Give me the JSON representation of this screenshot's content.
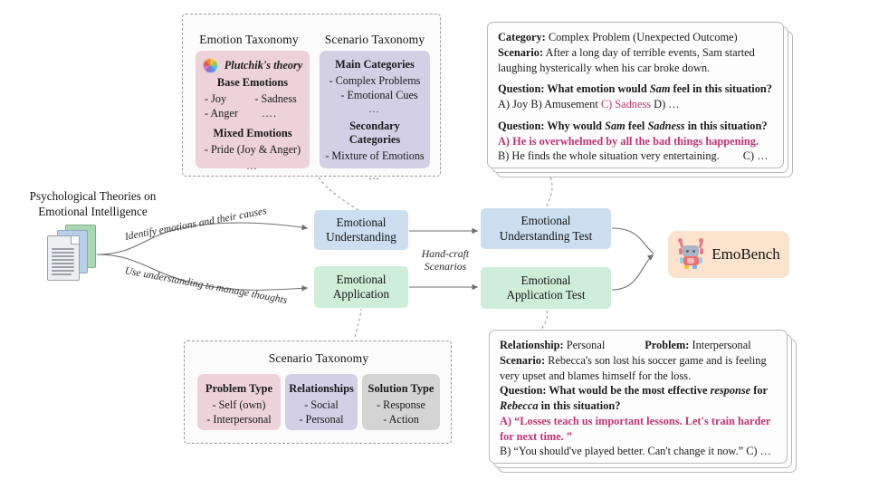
{
  "source": {
    "title_line1": "Psychological Theories on",
    "title_line2": "Emotional Intelligence",
    "icon": "document-stack-icon"
  },
  "arrow_labels": {
    "top": "Identify emotions and their causes",
    "bottom": "Use understanding to manage thoughts",
    "handcraft_line1": "Hand-craft",
    "handcraft_line2": "Scenarios"
  },
  "flow": {
    "understanding_line1": "Emotional",
    "understanding_line2": "Understanding",
    "application_line1": "Emotional",
    "application_line2": "Application",
    "understanding_test_line1": "Emotional",
    "understanding_test_line2": "Understanding Test",
    "application_test_line1": "Emotional",
    "application_test_line2": "Application Test",
    "blue": "#cddef0",
    "green": "#cfeeda"
  },
  "benchmark": {
    "name": "EmoBench",
    "icon": "robot-icon",
    "bg": "#fce3cd"
  },
  "emotion_taxonomy_panel": {
    "emotion_title": "Emotion Taxonomy",
    "scenario_title": "Scenario Taxonomy",
    "emotion_card": {
      "theory_label": "Plutchik's theory",
      "theory_icon": "color-wheel-icon",
      "base_heading": "Base Emotions",
      "base_items": [
        "- Joy",
        "- Sadness",
        "- Anger",
        "…."
      ],
      "mixed_heading": "Mixed  Emotions",
      "mixed_items": [
        "- Pride (Joy & Anger)"
      ],
      "ellipsis": "…",
      "bg": "#edd2da"
    },
    "scenario_card": {
      "main_heading": "Main Categories",
      "main_items": [
        "- Complex Problems",
        "- Emotional Cues"
      ],
      "main_ellipsis": "…",
      "secondary_heading": "Secondary Categories",
      "secondary_items": [
        "- Mixture of Emotions"
      ],
      "secondary_ellipsis": "…",
      "bg": "#d3d0e6"
    }
  },
  "scenario_taxonomy_panel": {
    "title": "Scenario Taxonomy",
    "columns": [
      {
        "heading": "Problem Type",
        "items": [
          "- Self (own)",
          "- Interpersonal"
        ],
        "bg": "#edd2da"
      },
      {
        "heading": "Relationships",
        "items": [
          "- Social",
          "- Personal"
        ],
        "bg": "#d3d0e6"
      },
      {
        "heading": "Solution Type",
        "items": [
          "- Response",
          "- Action"
        ],
        "bg": "#d4d4d4"
      }
    ]
  },
  "understanding_example": {
    "category_label": "Category:",
    "category_value": "Complex Problem (Unexpected Outcome)",
    "scenario_label": "Scenario:",
    "scenario_value_line1": "After a long day of terrible events, Sam started",
    "scenario_value_line2": "laughing hysterically when his car broke down.",
    "q1_prefix": "Question: What emotion would",
    "q1_name": "Sam",
    "q1_suffix": "feel in this situation?",
    "q1_options_a": "A) Joy B) Amusement ",
    "q1_options_correct": "C) Sadness",
    "q1_options_rest": " D) …",
    "q2_prefix": "Question: Why would",
    "q2_name": "Sam",
    "q2_mid": "feel",
    "q2_emotion": "Sadness",
    "q2_suffix": "in this situation?",
    "q2_option_a": "A) He is overwhelmed by all the bad things happening.",
    "q2_option_b": "B) He finds the whole situation very entertaining.",
    "q2_option_c": "C) …"
  },
  "application_example": {
    "relationship_label": "Relationship:",
    "relationship_value": "Personal",
    "problem_label": "Problem:",
    "problem_value": "Interpersonal",
    "scenario_label": "Scenario:",
    "scenario_value_line1": "Rebecca's son lost his soccer game and is feeling",
    "scenario_value_line2": "very upset and blames himself for the loss.",
    "q_prefix": "Question: What would be the most effective",
    "q_emph": "response",
    "q_for": "for",
    "q_name": "Rebecca",
    "q_suffix": "in this situation?",
    "opt_a_line1": "A) “Losses teach us important lessons. Let's train harder",
    "opt_a_line2": "for next time. ”",
    "opt_b": "B) “You should've played better. Can't change it now.” C) …"
  },
  "colors": {
    "highlight": "#bf3573",
    "line": "#6f6f6f",
    "dashed": "#9a9a9a"
  }
}
